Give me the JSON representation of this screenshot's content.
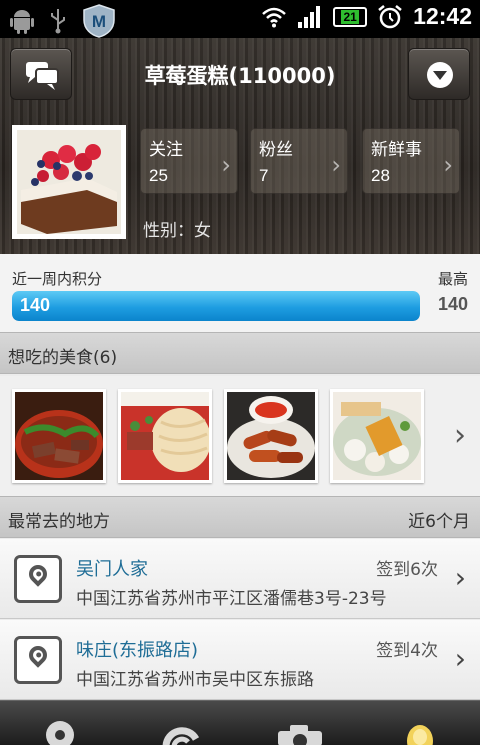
{
  "status_bar": {
    "time": "12:42",
    "battery": "21",
    "icons": [
      "android-icon",
      "usb-icon",
      "shield-m-icon",
      "wifi-icon",
      "signal-icon",
      "battery-icon",
      "alarm-icon"
    ]
  },
  "header": {
    "title": "草莓蛋糕(110000)",
    "left_icon": "chat-bubbles-icon",
    "right_icon": "dropdown-circle-icon",
    "stats": [
      {
        "label": "关注",
        "value": "25"
      },
      {
        "label": "粉丝",
        "value": "7"
      },
      {
        "label": "新鲜事",
        "value": "28"
      }
    ],
    "gender": "性别：女"
  },
  "score": {
    "label": "近一周内积分",
    "value": "140",
    "max_label": "最高",
    "max_value": "140",
    "progress": 1.0
  },
  "foods": {
    "title": "想吃的美食(6)"
  },
  "places": {
    "title": "最常去的地方",
    "period": "近6个月",
    "items": [
      {
        "name": "吴门人家",
        "checkin": "签到6次",
        "address": "中国江苏省苏州市平江区潘儒巷3号-23号"
      },
      {
        "name": "味庄(东振路店)",
        "checkin": "签到4次",
        "address": "中国江苏省苏州市吴中区东振路"
      }
    ]
  },
  "bottom_tabs": [
    "pin-tab-icon",
    "swirl-tab-icon",
    "camera-tab-icon",
    "bulb-tab-icon"
  ],
  "colors": {
    "accent_blue": "#1e9de1",
    "place_name": "#1f6d96"
  }
}
